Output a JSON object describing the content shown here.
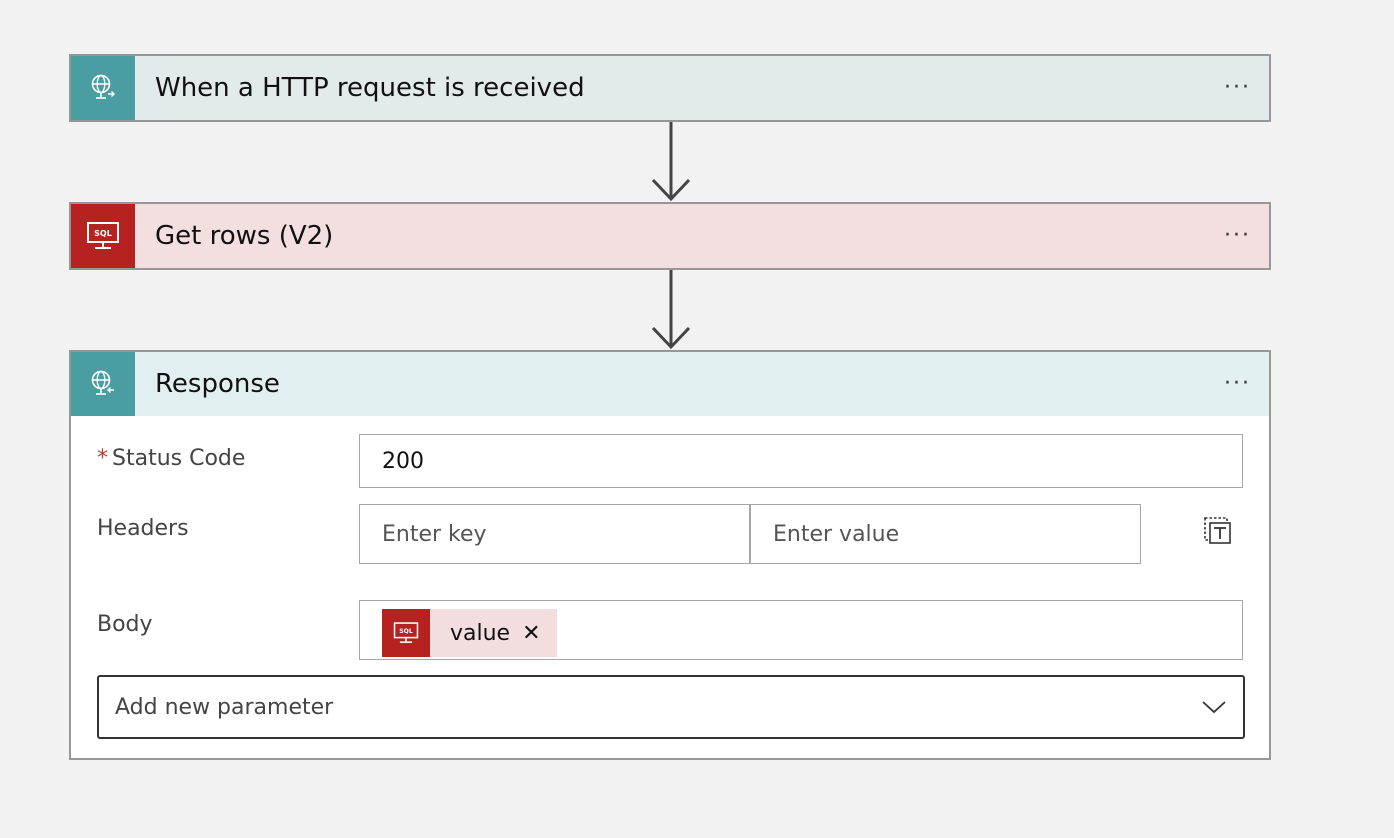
{
  "flow": {
    "trigger": {
      "title": "When a HTTP request is received",
      "more": "···",
      "icon": "http-request-icon",
      "header_color": "#e3eaec",
      "icon_color": "#4a9ea1"
    },
    "get_rows": {
      "title": "Get rows (V2)",
      "more": "···",
      "icon": "sql-icon",
      "header_color": "#f3dfdf",
      "icon_color": "#b5221f"
    },
    "response": {
      "title": "Response",
      "more": "···",
      "icon": "http-response-icon",
      "header_color": "#e1eff0",
      "icon_color": "#4a9ea1",
      "status_code": {
        "required_mark": "*",
        "label": "Status Code",
        "value": "200"
      },
      "headers": {
        "label": "Headers",
        "key_placeholder": "Enter key",
        "value_placeholder": "Enter value",
        "switch_icon": "text-mode-icon"
      },
      "body": {
        "label": "Body",
        "token_label": "value",
        "token_close": "✕",
        "token_icon": "sql-icon"
      },
      "add_parameter": {
        "label": "Add new parameter"
      }
    }
  }
}
